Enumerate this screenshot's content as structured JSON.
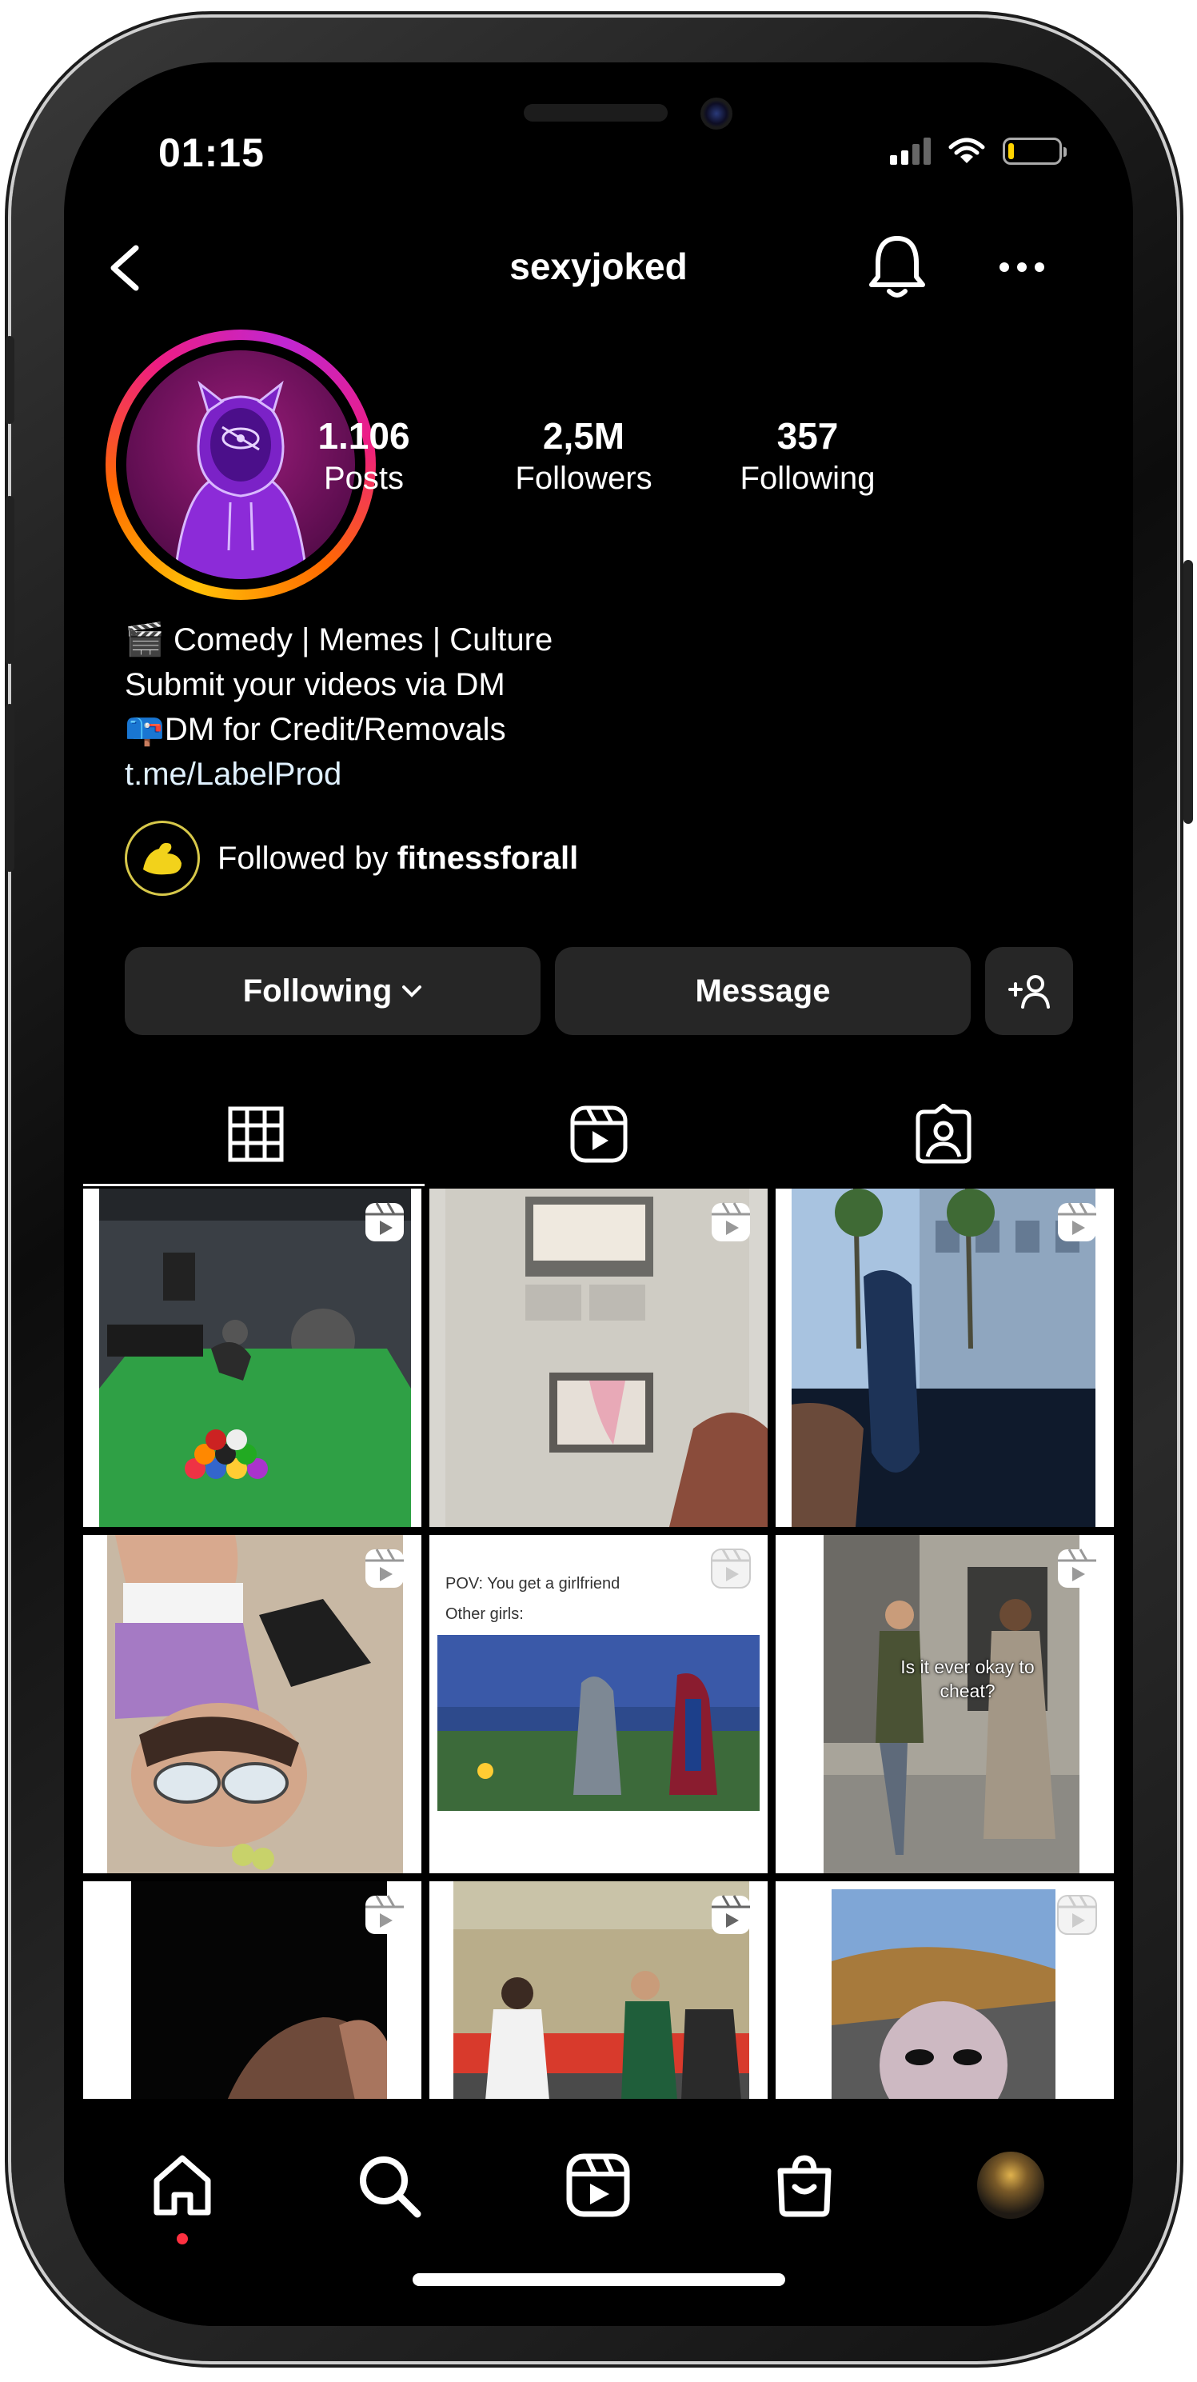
{
  "status_bar": {
    "time": "01:15",
    "battery_level": 0.12
  },
  "nav": {
    "username": "sexyjoked",
    "back_icon": "chevron-left-icon",
    "bell_icon": "bell-icon",
    "more_icon": "more-horizontal-icon"
  },
  "profile": {
    "stats": [
      {
        "value": "1.106",
        "label": "Posts"
      },
      {
        "value": "2,5M",
        "label": "Followers"
      },
      {
        "value": "357",
        "label": "Following"
      }
    ],
    "bio": {
      "line1": "Comedy | Memes | Culture",
      "line2": "Submit your videos via DM",
      "line3": "DM for Credit/Removals",
      "link": "t.me/LabelProd"
    },
    "followed_by": {
      "prefix": "Followed by ",
      "name": "fitnessforall"
    }
  },
  "actions": {
    "following": "Following",
    "message": "Message"
  },
  "tabs": [
    "grid-icon",
    "reels-icon",
    "tagged-icon"
  ],
  "posts": [
    {
      "caption_top": "",
      "caption_mid": "",
      "overlay": ""
    },
    {
      "caption_top": "",
      "caption_mid": "",
      "overlay": ""
    },
    {
      "caption_top": "",
      "caption_mid": "",
      "overlay": ""
    },
    {
      "caption_top": "",
      "caption_mid": "",
      "overlay": ""
    },
    {
      "caption_top": "POV: You get a girlfriend",
      "caption_mid": "Other girls:",
      "overlay": ""
    },
    {
      "caption_top": "",
      "caption_mid": "",
      "overlay": "Is it ever okay to cheat?"
    },
    {
      "caption_top": "",
      "caption_mid": "",
      "overlay": ""
    },
    {
      "caption_top": "",
      "caption_mid": "",
      "overlay": ""
    },
    {
      "caption_top": "",
      "caption_mid": "",
      "overlay": ""
    }
  ],
  "bottom_nav": [
    "home-icon",
    "search-icon",
    "reels-icon",
    "shop-icon",
    "profile-avatar"
  ]
}
